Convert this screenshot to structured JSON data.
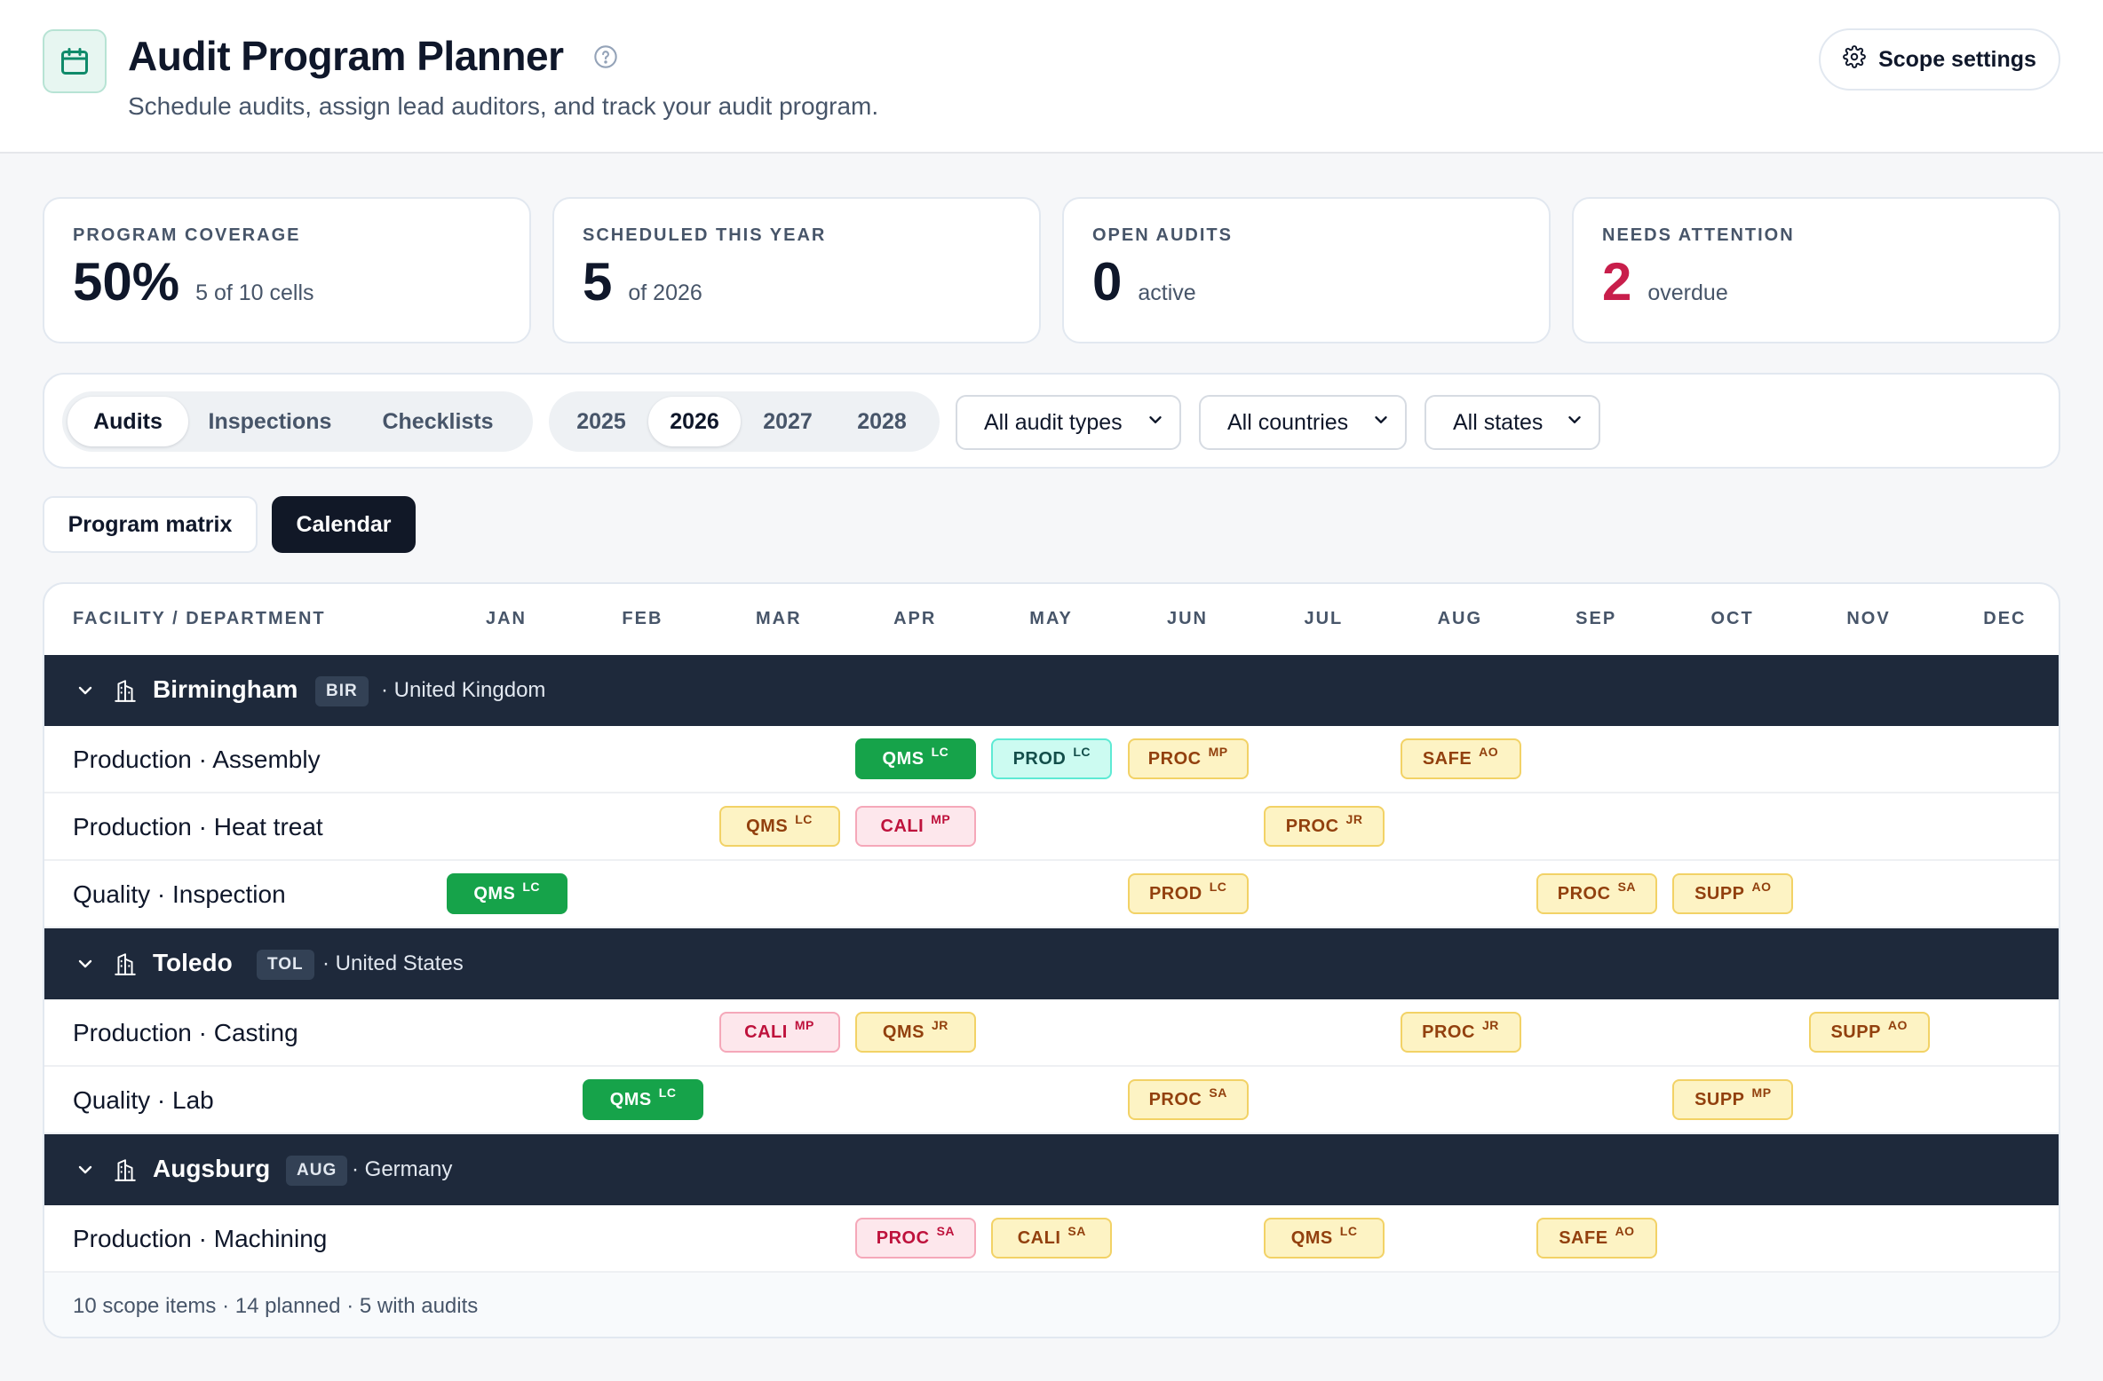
{
  "header": {
    "title": "Audit Program Planner",
    "subtitle": "Schedule audits, assign lead auditors, and track your audit program.",
    "scope_button": "Scope settings",
    "icons": {
      "app": "calendar-icon",
      "help": "help-circle-icon",
      "settings": "gear-icon"
    }
  },
  "kpis": [
    {
      "label": "PROGRAM COVERAGE",
      "value": "50%",
      "sub": "5 of 10 cells"
    },
    {
      "label": "SCHEDULED THIS YEAR",
      "value": "5",
      "sub": "of 2026"
    },
    {
      "label": "OPEN AUDITS",
      "value": "0",
      "sub": "active"
    },
    {
      "label": "NEEDS ATTENTION",
      "value": "2",
      "sub": "overdue",
      "value_color": "#c81e4b"
    }
  ],
  "filters": {
    "modes": [
      "Audits",
      "Inspections",
      "Checklists"
    ],
    "active_mode": "Audits",
    "years": [
      "2025",
      "2026",
      "2027",
      "2028"
    ],
    "active_year": "2026",
    "audit_type": "All audit types",
    "country": "All countries",
    "state": "All states"
  },
  "views": {
    "matrix": "Program matrix",
    "calendar": "Calendar",
    "active": "Calendar"
  },
  "calendar": {
    "header_label": "FACILITY / DEPARTMENT",
    "months": [
      "JAN",
      "FEB",
      "MAR",
      "APR",
      "MAY",
      "JUN",
      "JUL",
      "AUG",
      "SEP",
      "OCT",
      "NOV",
      "DEC"
    ],
    "status_colors": {
      "completed": "#16a34a",
      "in_progress": "#5eead4",
      "planned": "#f2d266",
      "overdue": "#f5a8b9"
    },
    "facilities": [
      {
        "name": "Birmingham",
        "code": "BIR",
        "country": "· United Kingdom",
        "departments": [
          {
            "label": "Production · Assembly",
            "audits": [
              {
                "type": "QMS",
                "auditor": "LC",
                "month": 4,
                "status": "completed"
              },
              {
                "type": "PROD",
                "auditor": "LC",
                "month": 5,
                "status": "in_progress"
              },
              {
                "type": "PROC",
                "auditor": "MP",
                "month": 6,
                "status": "planned"
              },
              {
                "type": "SAFE",
                "auditor": "AO",
                "month": 8,
                "status": "planned"
              }
            ]
          },
          {
            "label": "Production · Heat treat",
            "audits": [
              {
                "type": "QMS",
                "auditor": "LC",
                "month": 3,
                "status": "planned"
              },
              {
                "type": "CALI",
                "auditor": "MP",
                "month": 4,
                "status": "overdue"
              },
              {
                "type": "PROC",
                "auditor": "JR",
                "month": 7,
                "status": "planned"
              }
            ]
          },
          {
            "label": "Quality · Inspection",
            "audits": [
              {
                "type": "QMS",
                "auditor": "LC",
                "month": 1,
                "status": "completed"
              },
              {
                "type": "PROD",
                "auditor": "LC",
                "month": 6,
                "status": "planned"
              },
              {
                "type": "PROC",
                "auditor": "SA",
                "month": 9,
                "status": "planned"
              },
              {
                "type": "SUPP",
                "auditor": "AO",
                "month": 10,
                "status": "planned"
              }
            ]
          }
        ]
      },
      {
        "name": "Toledo",
        "code": "TOL",
        "country": "· United States",
        "departments": [
          {
            "label": "Production · Casting",
            "audits": [
              {
                "type": "CALI",
                "auditor": "MP",
                "month": 3,
                "status": "overdue"
              },
              {
                "type": "QMS",
                "auditor": "JR",
                "month": 4,
                "status": "planned"
              },
              {
                "type": "PROC",
                "auditor": "JR",
                "month": 8,
                "status": "planned"
              },
              {
                "type": "SUPP",
                "auditor": "AO",
                "month": 11,
                "status": "planned"
              }
            ]
          },
          {
            "label": "Quality · Lab",
            "audits": [
              {
                "type": "QMS",
                "auditor": "LC",
                "month": 2,
                "status": "completed"
              },
              {
                "type": "PROC",
                "auditor": "SA",
                "month": 6,
                "status": "planned"
              },
              {
                "type": "SUPP",
                "auditor": "MP",
                "month": 10,
                "status": "planned"
              }
            ]
          }
        ]
      },
      {
        "name": "Augsburg",
        "code": "AUG",
        "country": "· Germany",
        "departments": [
          {
            "label": "Production · Machining",
            "audits": [
              {
                "type": "PROC",
                "auditor": "SA",
                "month": 4,
                "status": "overdue"
              },
              {
                "type": "CALI",
                "auditor": "SA",
                "month": 5,
                "status": "planned"
              },
              {
                "type": "QMS",
                "auditor": "LC",
                "month": 7,
                "status": "planned"
              },
              {
                "type": "SAFE",
                "auditor": "AO",
                "month": 9,
                "status": "planned"
              }
            ]
          }
        ]
      }
    ],
    "footer": "10 scope items · 14 planned · 5 with audits"
  }
}
